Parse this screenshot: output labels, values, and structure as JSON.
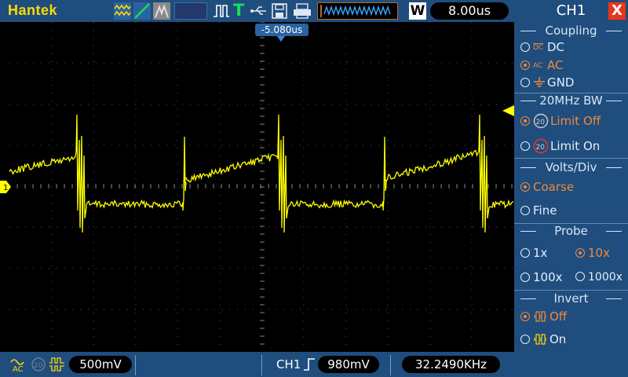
{
  "brand": "Hantek",
  "topbar": {
    "timebase": "8.00us",
    "timebase_badge": "W",
    "trigger_letter": "T"
  },
  "scope": {
    "trigger_position": "-5.080us",
    "channel_marker": "1",
    "trace_color": "#ffff00"
  },
  "bottombar": {
    "coupling_icon": "ac-coupling-icon",
    "volts": "500mV",
    "trigger_channel": "CH1",
    "trigger_level": "980mV",
    "frequency": "32.2490KHz"
  },
  "panel": {
    "title": "CH1",
    "close": "X",
    "coupling": {
      "header": "Coupling",
      "options": [
        {
          "label": "DC",
          "icon": "DC",
          "selected": false
        },
        {
          "label": "AC",
          "icon": "AC",
          "selected": true
        },
        {
          "label": "GND",
          "icon": "gnd",
          "selected": false
        }
      ]
    },
    "bw": {
      "header": "20MHz BW",
      "options": [
        {
          "label": "Limit Off",
          "icon": "20",
          "selected": true
        },
        {
          "label": "Limit On",
          "icon": "20",
          "selected": false
        }
      ]
    },
    "volts_div": {
      "header": "Volts/Div",
      "options": [
        {
          "label": "Coarse",
          "selected": true
        },
        {
          "label": "Fine",
          "selected": false
        }
      ]
    },
    "probe": {
      "header": "Probe",
      "options": [
        {
          "label": "1x",
          "selected": false
        },
        {
          "label": "10x",
          "selected": true
        },
        {
          "label": "100x",
          "selected": false
        },
        {
          "label": "1000x",
          "selected": false
        }
      ]
    },
    "invert": {
      "header": "Invert",
      "options": [
        {
          "label": "Off",
          "selected": true
        },
        {
          "label": "On",
          "selected": false
        }
      ]
    }
  },
  "colors": {
    "accent": "#1f4d7d",
    "selected": "#f08a3c",
    "trace": "#ffff00",
    "trigger_t": "#13e05a"
  }
}
